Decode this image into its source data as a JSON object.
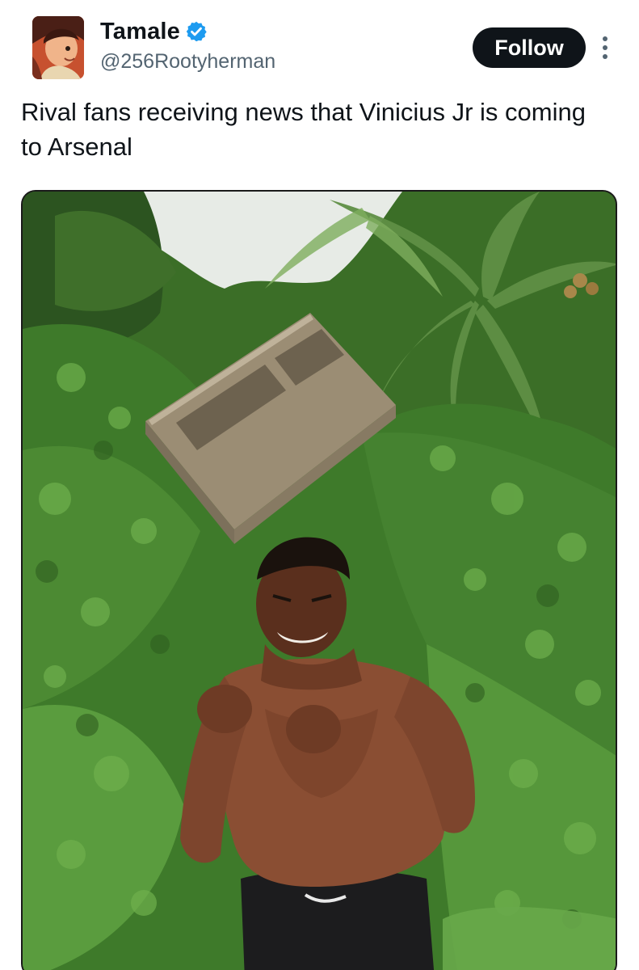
{
  "author": {
    "display_name": "Tamale",
    "handle": "@256Rootyherman",
    "verified": true,
    "verified_icon": "verified-badge-icon",
    "verified_color": "#1d9bf0"
  },
  "actions": {
    "follow_label": "Follow",
    "more_icon": "more-vertical-icon"
  },
  "tweet": {
    "text": "Rival fans receiving news that Vinicius Jr is coming to Arsenal"
  },
  "media": {
    "type": "photo",
    "background_color": "#3b6e27"
  },
  "colors": {
    "text_primary": "#0f1419",
    "text_secondary": "#536471",
    "button_bg": "#0f1419",
    "button_text": "#ffffff"
  }
}
